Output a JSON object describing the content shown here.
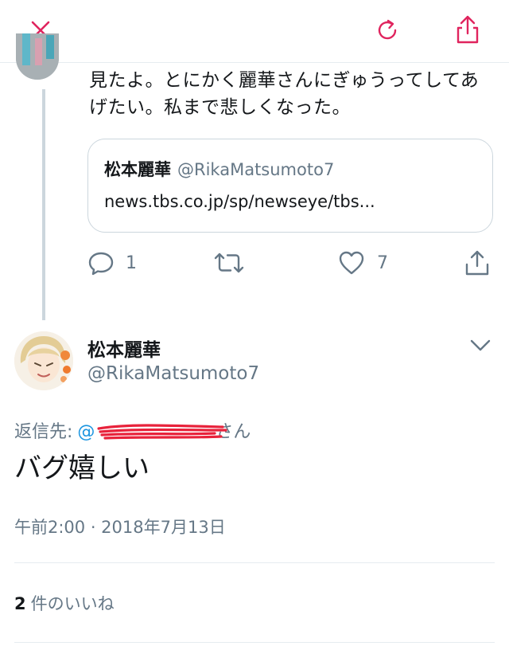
{
  "colors": {
    "accent_pink": "#e0245e",
    "link_blue": "#1b95e0",
    "secondary_text": "#657786",
    "border": "#ccd6dd"
  },
  "toolbar": {
    "close_icon": "x-close-icon",
    "reload_icon": "reload-icon",
    "share_icon": "share-icon"
  },
  "parent_tweet": {
    "text": "見たよ。とにかく麗華さんにぎゅうってしてあげたい。私まで悲しくなった。",
    "quoted": {
      "name": "松本麗華",
      "handle": "@RikaMatsumoto7",
      "link": "news.tbs.co.jp/sp/newseye/tbs..."
    },
    "actions": {
      "reply_count": "1",
      "retweet_count": "",
      "like_count": "7"
    }
  },
  "tweet": {
    "author_name": "松本麗華",
    "author_handle": "@RikaMatsumoto7",
    "reply_to_label": "返信先:",
    "reply_to_mention": "@",
    "reply_to_suffix": "さん",
    "text": "バグ嬉しい",
    "timestamp": "午前2:00 · 2018年7月13日",
    "likes_count": "2",
    "likes_label": "件のいいね"
  }
}
